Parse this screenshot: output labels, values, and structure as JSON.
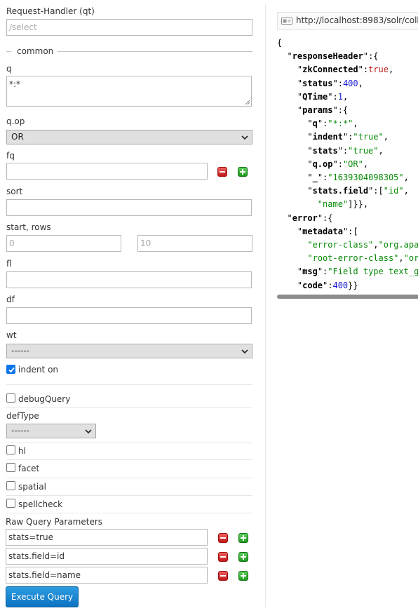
{
  "form": {
    "request_handler": {
      "label": "Request-Handler (qt)",
      "placeholder": "/select"
    },
    "common_legend": "common",
    "q": {
      "label": "q",
      "value": "*:*"
    },
    "q_op": {
      "label": "q.op",
      "selected": "OR"
    },
    "fq": {
      "label": "fq",
      "value": ""
    },
    "sort": {
      "label": "sort",
      "value": ""
    },
    "start_rows": {
      "label": "start, rows",
      "start_placeholder": "0",
      "rows_placeholder": "10"
    },
    "fl": {
      "label": "fl",
      "value": ""
    },
    "df": {
      "label": "df",
      "value": ""
    },
    "wt": {
      "label": "wt",
      "selected": "------"
    },
    "indent": {
      "label": "indent on",
      "checked": true
    },
    "debug_query": {
      "label": "debugQuery",
      "checked": false
    },
    "def_type": {
      "label": "defType",
      "selected": "------"
    },
    "hl": {
      "label": "hl",
      "checked": false
    },
    "facet": {
      "label": "facet",
      "checked": false
    },
    "spatial": {
      "label": "spatial",
      "checked": false
    },
    "spellcheck": {
      "label": "spellcheck",
      "checked": false
    },
    "raw_params": {
      "label": "Raw Query Parameters",
      "values": [
        "stats=true",
        "stats.field=id",
        "stats.field=name"
      ]
    },
    "execute_label": "Execute Query"
  },
  "response": {
    "url": "http://localhost:8983/solr/coll",
    "json": {
      "responseHeader": {
        "zkConnected": true,
        "status": 400,
        "QTime": 1,
        "params": {
          "q": "*:*",
          "indent": "true",
          "stats": "true",
          "q.op": "OR",
          "_": "1639304098305",
          "stats.field": [
            "id",
            "name"
          ]
        }
      },
      "error": {
        "metadata": [
          "error-class",
          "org.apa",
          "root-error-class",
          "or"
        ],
        "msg": "Field type text_g",
        "code": 400
      }
    }
  },
  "colors": {
    "accent": "#0c73c2",
    "string": "#088a08",
    "number": "#1818d6",
    "boolean": "#c02020",
    "remove_button": "#d32222",
    "add_button": "#2eaa2e"
  },
  "icons": {
    "remove": "minus-icon",
    "add": "plus-icon",
    "url": "link-icon",
    "select": "chevron-down-icon"
  }
}
